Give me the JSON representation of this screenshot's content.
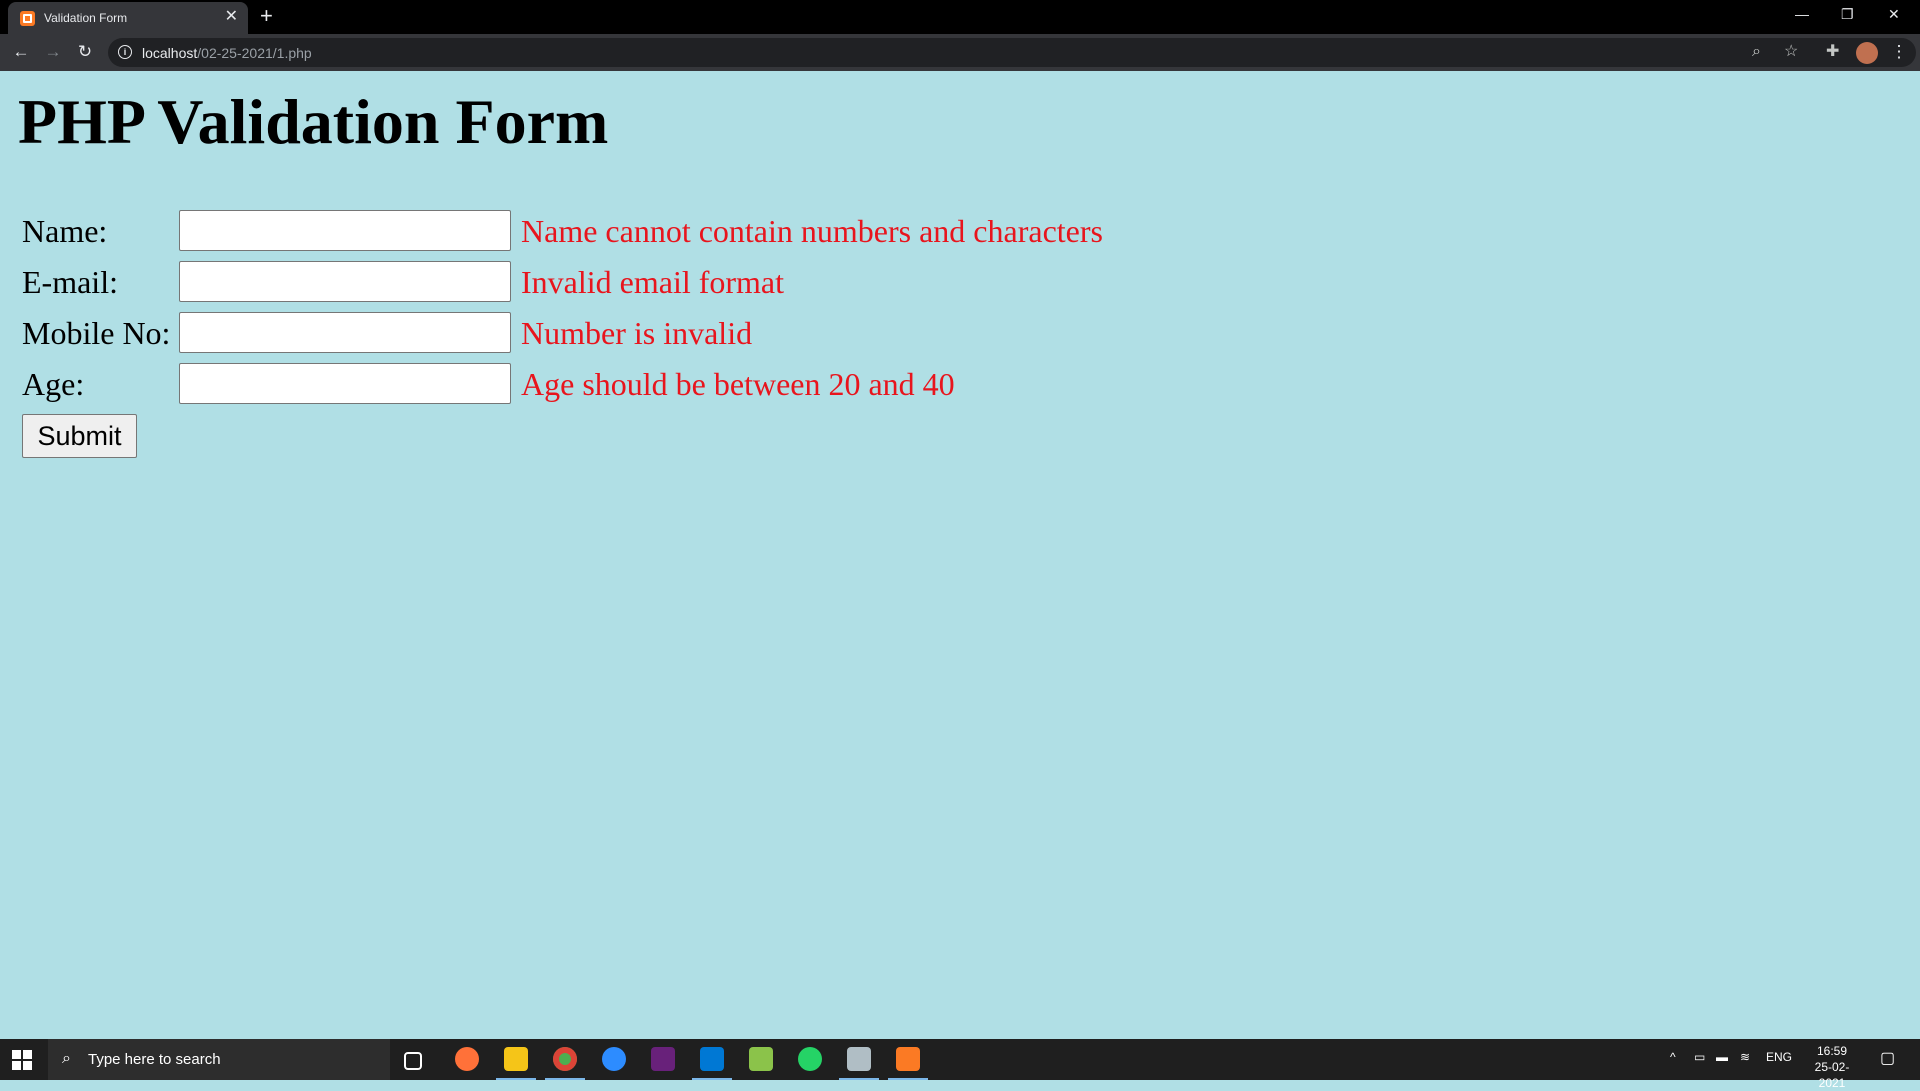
{
  "browser": {
    "tab_title": "Validation Form",
    "tab_close": "✕",
    "new_tab": "+",
    "url_host": "localhost",
    "url_path": "/02-25-2021/1.php",
    "window_minimize": "—",
    "window_restore": "❐",
    "window_close": "✕"
  },
  "page": {
    "heading": "PHP Validation Form",
    "fields": [
      {
        "label": "Name:",
        "value": "",
        "error": "Name cannot contain numbers and characters"
      },
      {
        "label": "E-mail:",
        "value": "",
        "error": "Invalid email format"
      },
      {
        "label": "Mobile No:",
        "value": "",
        "error": "Number is invalid"
      },
      {
        "label": "Age:",
        "value": "",
        "error": "Age should be between 20 and 40"
      }
    ],
    "submit_label": "Submit",
    "error_color": "#e8151d",
    "background_color": "#b0dfe5"
  },
  "taskbar": {
    "search_placeholder": "Type here to search",
    "language": "ENG",
    "time": "16:59",
    "date": "25-02-2021",
    "apps": [
      "task-view",
      "firefox",
      "file-explorer",
      "chrome",
      "zoom",
      "visual-studio",
      "vscode",
      "notepad-plus-plus",
      "whatsapp",
      "snipping-tool",
      "xampp"
    ]
  }
}
